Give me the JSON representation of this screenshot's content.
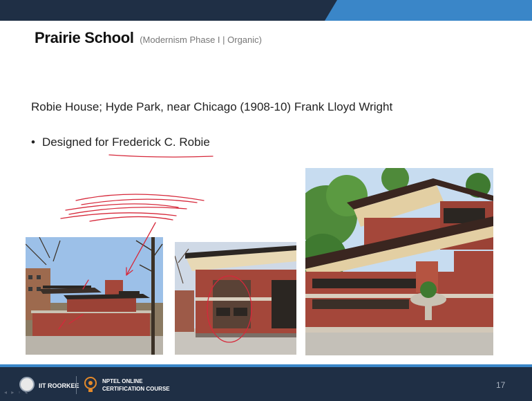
{
  "slide": {
    "title": "Prairie School",
    "subtitle": "(Modernism Phase I | Organic)",
    "line1": "Robie House; Hyde Park, near Chicago (1908-10) Frank Lloyd Wright",
    "bullet_symbol": "•",
    "bullet_prefix": "Designed for",
    "bullet_name": "Frederick C. Robie",
    "page_number": "17"
  },
  "footer": {
    "institute": "IIT ROORKEE",
    "course_line1": "NPTEL ONLINE",
    "course_line2": "CERTIFICATION COURSE"
  },
  "colors": {
    "header_dark": "#1f2f45",
    "header_accent": "#3a86c8",
    "annotation_red": "#d6283a",
    "brick": "#a4473a"
  },
  "icons": [
    "iit-roorkee-logo-icon",
    "nptel-logo-icon",
    "slide-nav-icons"
  ]
}
